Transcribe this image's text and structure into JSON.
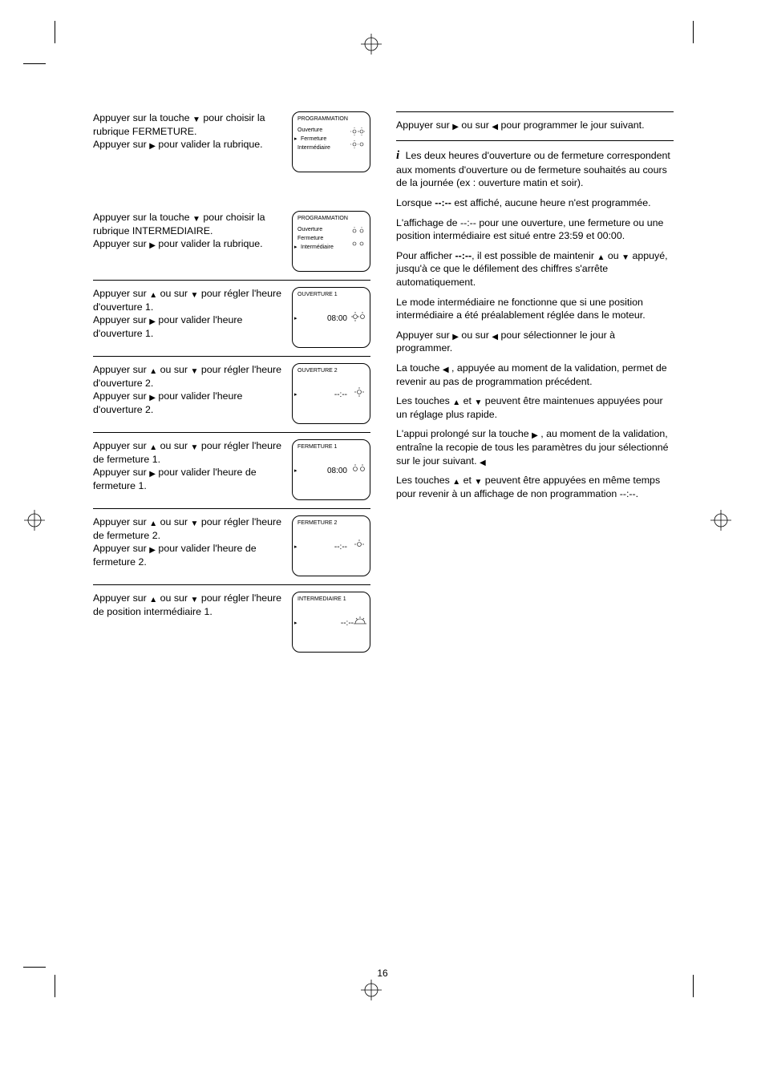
{
  "page_number": "16",
  "left_col": {
    "step2": {
      "text1": "Appuyer sur la touche",
      "text2": "pour choisir la rubrique FERMETURE.",
      "text3": "Appuyer sur",
      "text4": "pour valider la rubrique.",
      "screen": {
        "title": "PROGRAMMATION",
        "line1": "Ouverture",
        "line2": "Fermeture",
        "line3": "Intermédiaire"
      }
    },
    "step3": {
      "text1": "Appuyer sur la touche",
      "text2": "pour choisir la rubrique INTERMEDIAIRE.",
      "text3": "Appuyer sur",
      "text4": "pour valider la rubrique.",
      "screen": {
        "title": "PROGRAMMATION",
        "line1": "Ouverture",
        "line2": "Fermeture",
        "line3": "Intermédiaire"
      }
    },
    "step4": {
      "text1": "Appuyer sur",
      "text2": "ou sur",
      "text3": "pour régler l'heure d'ouverture 1.",
      "text4": "Appuyer sur",
      "text5": "pour valider l'heure d'ouverture 1.",
      "screen": {
        "title": "OUVERTURE 1",
        "value": "08:00"
      }
    },
    "step5": {
      "text1": "Appuyer sur",
      "text2": "ou sur",
      "text3": "pour régler l'heure d'ouverture 2.",
      "text4": "Appuyer sur",
      "text5": "pour valider l'heure d'ouverture 2.",
      "screen": {
        "title": "OUVERTURE 2",
        "value": "--:--"
      }
    },
    "step6": {
      "text1": "Appuyer sur",
      "text2": "ou sur",
      "text3": "pour régler l'heure de fermeture 1.",
      "text4": "Appuyer sur",
      "text5": "pour valider l'heure de fermeture 1.",
      "screen": {
        "title": "FERMETURE 1",
        "value": "08:00"
      }
    },
    "step7": {
      "text1": "Appuyer sur",
      "text2": "ou sur",
      "text3": "pour régler l'heure de fermeture 2.",
      "text4": "Appuyer sur",
      "text5": "pour valider l'heure de fermeture 2.",
      "screen": {
        "title": "FERMETURE 2",
        "value": "--:--"
      }
    },
    "step8": {
      "text1": "Appuyer sur",
      "text2": "ou sur",
      "text3": "pour régler l'heure de position intermédiaire 1.",
      "screen": {
        "title": "INTERMEDIAIRE 1",
        "value": "--:--"
      }
    }
  },
  "right_col": {
    "step9": {
      "text1": "Appuyer sur",
      "text2": "ou sur",
      "text3": "pour programmer le jour suivant."
    },
    "notei": {
      "label_i": "i",
      "text1": "Les deux heures d'ouverture ou de fermeture correspondent aux moments d'ouverture ou de fermeture souhaités au cours de la journée (ex : ouverture matin et soir).",
      "text2_a": "Lorsque",
      "text2_b": "est affiché, aucune heure n'est programmée.",
      "none_value": "--:--",
      "text3": "L'affichage de --:-- pour une ouverture, une fermeture ou une position intermédiaire est situé entre 23:59 et 00:00.",
      "text4_a": "Pour afficher",
      "text4_b": "il est possible de maintenir",
      "text4_c": "ou",
      "text4_d": "appuyé, jusqu'à ce que le défilement des chiffres s'arrête automatiquement.",
      "text5": "Le mode intermédiaire ne fonctionne que si une position intermédiaire a été préalablement réglée dans le moteur.",
      "text6_a": "Appuyer sur",
      "text6_b": "ou sur",
      "text6_c": "pour sélectionner le jour à programmer.",
      "text7_a": "L'appui prolongé sur la touche",
      "text7_b": ", au moment de la validation, entraîne la recopie de tous les paramètres du jour sélectionné sur le jour suivant.",
      "text8_a": "Les touches",
      "text8_b": "et",
      "text8_c": "peuvent être maintenues appuyées pour un réglage plus rapide.",
      "text9_a": "La touche",
      "text9_b": ", appuyée au moment de la validation, permet de revenir au pas de programmation précédent.",
      "text10_a": "Les touches",
      "text10_b": "et",
      "text10_c": "peuvent être appuyées en même temps pour revenir à un affichage de non programmation --:--."
    }
  }
}
